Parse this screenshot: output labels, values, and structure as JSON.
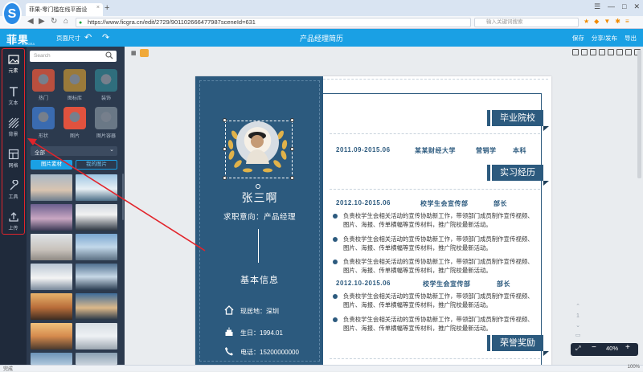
{
  "browser": {
    "tab_title": "菲果-零门槛在线平面设",
    "tab_close": "×",
    "new_tab": "+",
    "url": "https://www.ficgra.cn/edit/2729/901102666477987sceneId=631",
    "search_placeholder": "输入关键词搜索",
    "win_controls": [
      "☰",
      "—",
      "□",
      "✕"
    ],
    "logo_letter": "S"
  },
  "app": {
    "logo_text": "菲果",
    "logo_sub": "FICGRA",
    "page_size": "页面尺寸",
    "undo": "↶",
    "redo": "↷",
    "doc_title": "产品经理简历",
    "save": "保存",
    "share": "分享/发布",
    "export": "导出"
  },
  "rail": {
    "items": [
      {
        "label": "元素",
        "icon": "image-icon",
        "active": true
      },
      {
        "label": "文本",
        "icon": "text-icon"
      },
      {
        "label": "背景",
        "icon": "background-icon"
      },
      {
        "label": "网格",
        "icon": "grid-icon"
      },
      {
        "label": "工具",
        "icon": "tools-icon"
      },
      {
        "label": "上传",
        "icon": "upload-icon"
      }
    ]
  },
  "panel": {
    "search_placeholder": "Search",
    "categories": [
      {
        "label": "热门",
        "color": "#b94f3e"
      },
      {
        "label": "图标库",
        "color": "#9a7a3a"
      },
      {
        "label": "装饰",
        "color": "#2f6e7d"
      },
      {
        "label": "形状",
        "color": "#3a6bb0"
      },
      {
        "label": "图片",
        "color": "#e1523e"
      },
      {
        "label": "图片容器",
        "color": "#6a7886"
      }
    ],
    "dropdown_value": "全部",
    "tab_materials": "图片素材",
    "tab_mine": "我的图片"
  },
  "canvas": {
    "page_indicator": "1",
    "zoom_minus": "−",
    "zoom_level": "40%",
    "zoom_plus": "+",
    "up_arrow": "⌃",
    "down_arrow": "⌄"
  },
  "resume": {
    "name": "张三啊",
    "intent": "求职意向：产品经理",
    "basic_info": "基本信息",
    "address": "现居地：深圳",
    "birthday": "生日：1994.01",
    "phone": "电话：15200000000",
    "sections": {
      "education": "毕业院校",
      "experience": "实习经历",
      "awards": "荣誉奖励"
    },
    "education_row": {
      "period": "2011.09-2015.06",
      "school": "某某财经大学",
      "major": "营销学",
      "degree": "本科"
    },
    "jobs": [
      {
        "period": "2012.10-2015.06",
        "org": "校学生会宣传部",
        "role": "部长",
        "bullets": [
          "负责校学生会相关活动的宣传协助新工作，带领部门成员制作宣传视频、图片、海报、传单横幅等宣传材料，推广院校最新活动。",
          "负责校学生会相关活动的宣传协助新工作，带领部门成员制作宣传视频、图片、海报、传单横幅等宣传材料，推广院校最新活动。",
          "负责校学生会相关活动的宣传协助新工作，带领部门成员制作宣传视频、图片、海报、传单横幅等宣传材料，推广院校最新活动。"
        ]
      },
      {
        "period": "2012.10-2015.06",
        "org": "校学生会宣传部",
        "role": "部长",
        "bullets": [
          "负责校学生会相关活动的宣传协助新工作，带领部门成员制作宣传视频、图片、海报、传单横幅等宣传材料，推广院校最新活动。",
          "负责校学生会相关活动的宣传协助新工作，带领部门成员制作宣传视频、图片、海报、传单横幅等宣传材料，推广院校最新活动。"
        ]
      }
    ]
  },
  "status": {
    "left": "完成",
    "right": "100%"
  },
  "colors": {
    "brand": "#1aa0e4",
    "resume_blue": "#2c5a7e",
    "annotation_red": "#e2242b",
    "rail_bg": "#1f2a3b",
    "panel_bg": "#2c3a4e"
  }
}
